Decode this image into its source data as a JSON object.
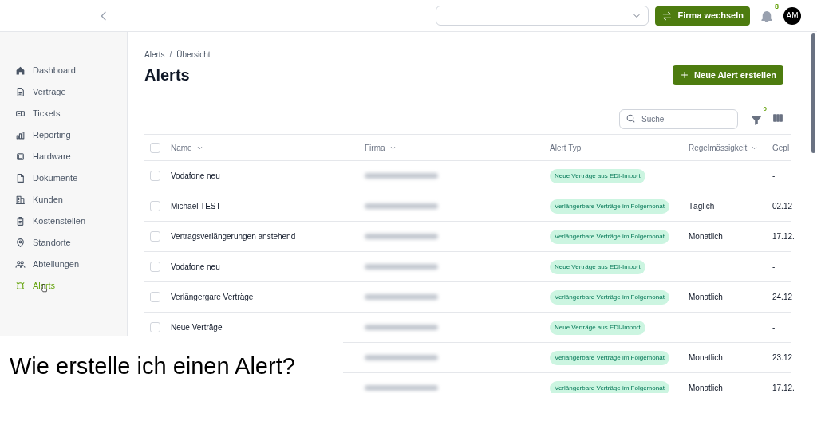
{
  "topbar": {
    "switch_button": "Firma wechseln",
    "notifications": {
      "count": "8"
    },
    "avatar": "AM"
  },
  "sidebar": {
    "items": [
      {
        "label": "Dashboard",
        "selected": false
      },
      {
        "label": "Verträge",
        "selected": false
      },
      {
        "label": "Tickets",
        "selected": false
      },
      {
        "label": "Reporting",
        "selected": false
      },
      {
        "label": "Hardware",
        "selected": false
      },
      {
        "label": "Dokumente",
        "selected": false
      },
      {
        "label": "Kunden",
        "selected": false
      },
      {
        "label": "Kostenstellen",
        "selected": false
      },
      {
        "label": "Standorte",
        "selected": false
      },
      {
        "label": "Abteilungen",
        "selected": false
      },
      {
        "label": "Alerts",
        "selected": true
      }
    ]
  },
  "breadcrumb": [
    "Alerts",
    "Übersicht"
  ],
  "breadcrumb_separator": "/",
  "title": "Alerts",
  "create_button": "Neue Alert erstellen",
  "search": {
    "placeholder": "Suche"
  },
  "filter": {
    "count": "0"
  },
  "table": {
    "select_all": {
      "checked": false
    },
    "columns": [
      {
        "label": "Name",
        "sortable": true
      },
      {
        "label": "Firma",
        "sortable": true
      },
      {
        "label": "Alert Typ",
        "sortable": false
      },
      {
        "label": "Regelmässigkeit",
        "sortable": true
      },
      {
        "label": "Gepl",
        "sortable": false
      }
    ],
    "rows": [
      {
        "checked": false,
        "name": "Vodafone neu",
        "type": "Neue Verträge aus EDI-Import",
        "planned": "-"
      },
      {
        "checked": false,
        "name": "Michael TEST",
        "type": "Verlängerbare Verträge im Folgemonat",
        "frequency": "Täglich",
        "planned": "02.12"
      },
      {
        "checked": false,
        "name": "Vertragsverlängerungen anstehend",
        "type": "Verlängerbare Verträge im Folgemonat",
        "frequency": "Monatlich",
        "planned": "17.12."
      },
      {
        "checked": false,
        "name": "Vodafone neu",
        "type": "Neue Verträge aus EDI-Import",
        "planned": "-"
      },
      {
        "checked": false,
        "name": "Verlängergare Verträge",
        "type": "Verlängerbare Verträge im Folgemonat",
        "frequency": "Monatlich",
        "planned": "24.12"
      },
      {
        "checked": false,
        "name": "Neue Verträge",
        "type": "Neue Verträge aus EDI-Import",
        "planned": "-"
      },
      {
        "type": "Verlängerbare Verträge im Folgemonat",
        "frequency": "Monatlich",
        "planned": "23.12"
      },
      {
        "type": "Verlängerbare Verträge im Folgemonat",
        "frequency": "Monatlich",
        "planned": "17.12."
      }
    ]
  },
  "caption": "Wie erstelle ich einen Alert?"
}
